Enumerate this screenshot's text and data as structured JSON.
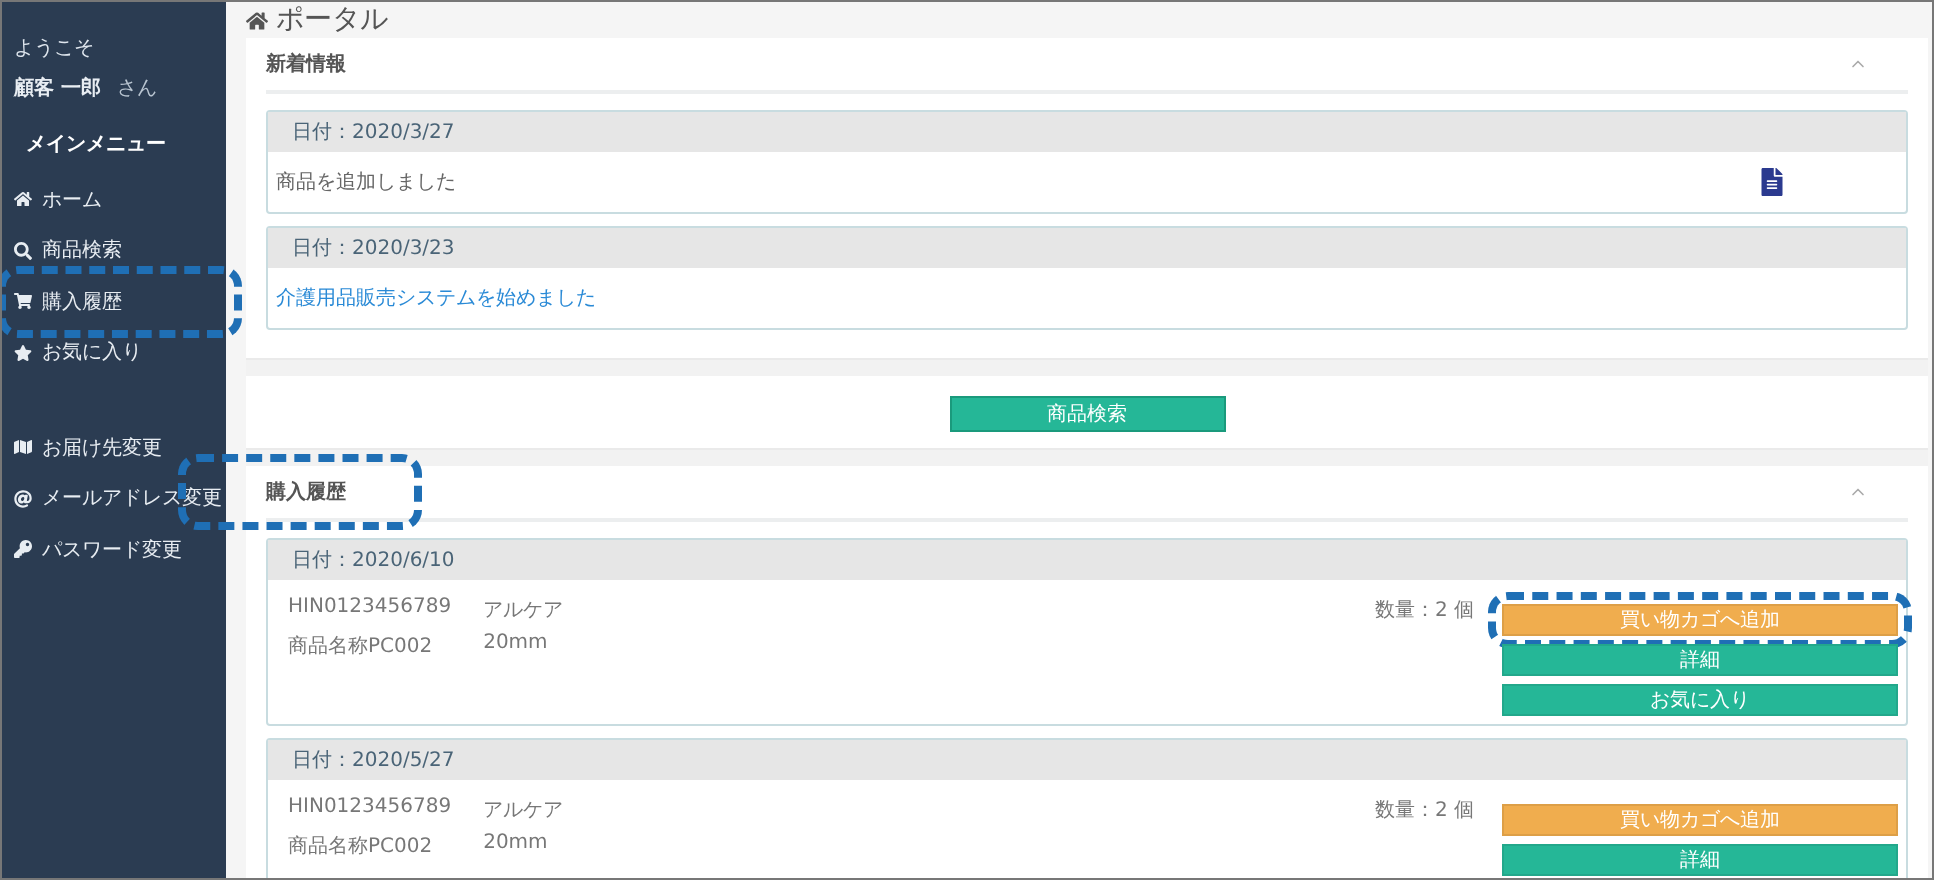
{
  "page": {
    "title": "ポータル"
  },
  "sidebar": {
    "welcome": "ようこそ",
    "user_name": "顧客 一郎",
    "honorific": "さん",
    "menu_heading": "メインメニュー",
    "groups": [
      [
        {
          "label": "ホーム",
          "highlighted": false
        },
        {
          "label": "商品検索",
          "highlighted": false
        },
        {
          "label": "購入履歴",
          "highlighted": true
        },
        {
          "label": "お気に入り",
          "highlighted": false
        }
      ],
      [
        {
          "label": "お届け先変更",
          "highlighted": false
        },
        {
          "label": "メールアドレス変更",
          "highlighted": false
        },
        {
          "label": "パスワード変更",
          "highlighted": false
        }
      ]
    ]
  },
  "news": {
    "title": "新着情報",
    "expanded": true,
    "items": [
      {
        "date": "日付：2020/3/27",
        "text": "商品を追加しました",
        "kind": "plain",
        "attachment": true
      },
      {
        "date": "日付：2020/3/23",
        "text": "介護用品販売システムを始めました",
        "kind": "link",
        "attachment": false
      }
    ]
  },
  "search_button": "商品検索",
  "history": {
    "title": "購入履歴",
    "highlighted": true,
    "expanded": true,
    "orders": [
      {
        "date": "日付：2020/6/10",
        "code": "HIN0123456789",
        "maker": "アルケア",
        "name": "商品名称PC002",
        "size": "20mm",
        "quantity": "数量：2 個",
        "buttons": [
          {
            "label": "買い物カゴへ追加",
            "kind": "cart",
            "highlighted": true
          },
          {
            "label": "詳細",
            "kind": "detail",
            "highlighted": false
          },
          {
            "label": "お気に入り",
            "kind": "favorite",
            "highlighted": false
          }
        ]
      },
      {
        "date": "日付：2020/5/27",
        "code": "HIN0123456789",
        "maker": "アルケア",
        "name": "商品名称PC002",
        "size": "20mm",
        "quantity": "数量：2 個",
        "buttons": [
          {
            "label": "買い物カゴへ追加",
            "kind": "cart",
            "highlighted": false
          },
          {
            "label": "詳細",
            "kind": "detail",
            "highlighted": false
          }
        ]
      }
    ]
  }
}
